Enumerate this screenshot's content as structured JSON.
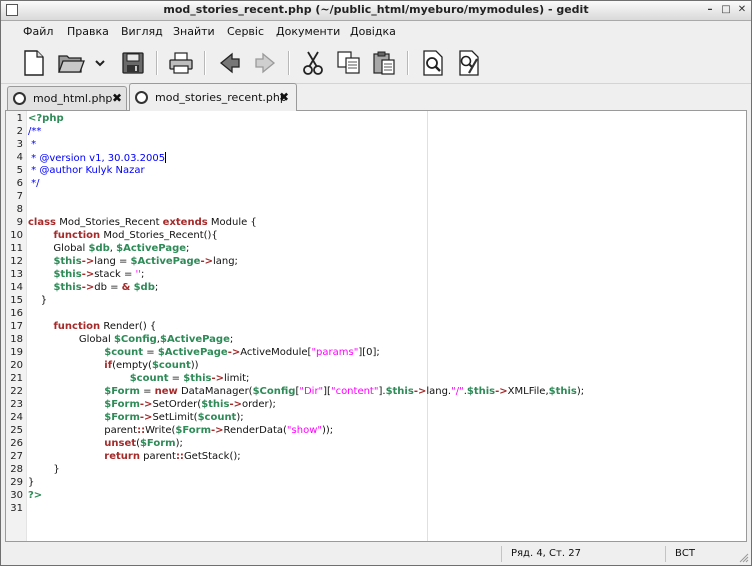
{
  "window": {
    "title": "mod_stories_recent.php (~/public_html/myeburo/mymodules) - gedit",
    "buttons": {
      "minimize": "–",
      "maximize": "□",
      "close": "✕"
    }
  },
  "menu": [
    "Файл",
    "Правка",
    "Вигляд",
    "Знайти",
    "Сервіс",
    "Документи",
    "Довідка"
  ],
  "toolbar": {
    "icons": [
      "new-document-icon",
      "open-folder-icon",
      "dropdown-arrow-icon",
      "save-icon",
      "print-icon",
      "back-arrow-icon",
      "forward-arrow-icon",
      "cut-icon",
      "copy-icon",
      "paste-icon",
      "find-icon",
      "replace-icon"
    ]
  },
  "tabs": [
    {
      "label": "mod_html.php",
      "close": "✖",
      "active": false
    },
    {
      "label": "mod_stories_recent.php",
      "close": "✖",
      "active": true
    }
  ],
  "editor": {
    "line_numbers": [
      "1",
      "2",
      "3",
      "4",
      "5",
      "6",
      "7",
      "8",
      "9",
      "10",
      "11",
      "12",
      "13",
      "14",
      "15",
      "16",
      "17",
      "18",
      "19",
      "20",
      "21",
      "22",
      "23",
      "24",
      "25",
      "26",
      "27",
      "28",
      "29",
      "30",
      "31"
    ],
    "lines": [
      [
        {
          "t": "<?php",
          "c": "v"
        }
      ],
      [
        {
          "t": "/**",
          "c": "c"
        }
      ],
      [
        {
          "t": " *",
          "c": "c"
        }
      ],
      [
        {
          "t": " * @version v1, 30.03.2005",
          "c": "c"
        }
      ],
      [
        {
          "t": " * @author Kulyk Nazar",
          "c": "c"
        }
      ],
      [
        {
          "t": " */",
          "c": "c"
        }
      ],
      [],
      [],
      [
        {
          "t": "class",
          "c": "k"
        },
        {
          "t": " Mod_Stories_Recent "
        },
        {
          "t": "extends",
          "c": "k"
        },
        {
          "t": " Module {"
        }
      ],
      [
        {
          "t": "        "
        },
        {
          "t": "function",
          "c": "k"
        },
        {
          "t": " Mod_Stories_Recent(){"
        }
      ],
      [
        {
          "t": "        Global "
        },
        {
          "t": "$db",
          "c": "v"
        },
        {
          "t": ", "
        },
        {
          "t": "$ActivePage",
          "c": "v"
        },
        {
          "t": ";"
        }
      ],
      [
        {
          "t": "        "
        },
        {
          "t": "$this",
          "c": "v"
        },
        {
          "t": "->",
          "c": "k"
        },
        {
          "t": "lang = "
        },
        {
          "t": "$ActivePage",
          "c": "v"
        },
        {
          "t": "->",
          "c": "k"
        },
        {
          "t": "lang;"
        }
      ],
      [
        {
          "t": "        "
        },
        {
          "t": "$this",
          "c": "v"
        },
        {
          "t": "->",
          "c": "k"
        },
        {
          "t": "stack = "
        },
        {
          "t": "''",
          "c": "s"
        },
        {
          "t": ";"
        }
      ],
      [
        {
          "t": "        "
        },
        {
          "t": "$this",
          "c": "v"
        },
        {
          "t": "->",
          "c": "k"
        },
        {
          "t": "db = "
        },
        {
          "t": "&",
          "c": "k"
        },
        {
          "t": " "
        },
        {
          "t": "$db",
          "c": "v"
        },
        {
          "t": ";"
        }
      ],
      [
        {
          "t": "    }"
        }
      ],
      [],
      [
        {
          "t": "        "
        },
        {
          "t": "function",
          "c": "k"
        },
        {
          "t": " Render() {"
        }
      ],
      [
        {
          "t": "                Global "
        },
        {
          "t": "$Config",
          "c": "v"
        },
        {
          "t": ","
        },
        {
          "t": "$ActivePage",
          "c": "v"
        },
        {
          "t": ";"
        }
      ],
      [
        {
          "t": "                        "
        },
        {
          "t": "$count",
          "c": "v"
        },
        {
          "t": " = "
        },
        {
          "t": "$ActivePage",
          "c": "v"
        },
        {
          "t": "->",
          "c": "k"
        },
        {
          "t": "ActiveModule["
        },
        {
          "t": "\"params\"",
          "c": "s"
        },
        {
          "t": "][0];"
        }
      ],
      [
        {
          "t": "                        "
        },
        {
          "t": "if",
          "c": "k"
        },
        {
          "t": "(empty("
        },
        {
          "t": "$count",
          "c": "v"
        },
        {
          "t": "))"
        }
      ],
      [
        {
          "t": "                                "
        },
        {
          "t": "$count",
          "c": "v"
        },
        {
          "t": " = "
        },
        {
          "t": "$this",
          "c": "v"
        },
        {
          "t": "->",
          "c": "k"
        },
        {
          "t": "limit;"
        }
      ],
      [
        {
          "t": "                        "
        },
        {
          "t": "$Form",
          "c": "v"
        },
        {
          "t": " = "
        },
        {
          "t": "new",
          "c": "k"
        },
        {
          "t": " DataManager("
        },
        {
          "t": "$Config",
          "c": "v"
        },
        {
          "t": "["
        },
        {
          "t": "\"Dir\"",
          "c": "s"
        },
        {
          "t": "]["
        },
        {
          "t": "\"content\"",
          "c": "s"
        },
        {
          "t": "]."
        },
        {
          "t": "$this",
          "c": "v"
        },
        {
          "t": "->",
          "c": "k"
        },
        {
          "t": "lang."
        },
        {
          "t": "\"/\"",
          "c": "s"
        },
        {
          "t": "."
        },
        {
          "t": "$this",
          "c": "v"
        },
        {
          "t": "->",
          "c": "k"
        },
        {
          "t": "XMLFile,"
        },
        {
          "t": "$this",
          "c": "v"
        },
        {
          "t": ");"
        }
      ],
      [
        {
          "t": "                        "
        },
        {
          "t": "$Form",
          "c": "v"
        },
        {
          "t": "->",
          "c": "k"
        },
        {
          "t": "SetOrder("
        },
        {
          "t": "$this",
          "c": "v"
        },
        {
          "t": "->",
          "c": "k"
        },
        {
          "t": "order);"
        }
      ],
      [
        {
          "t": "                        "
        },
        {
          "t": "$Form",
          "c": "v"
        },
        {
          "t": "->",
          "c": "k"
        },
        {
          "t": "SetLimit("
        },
        {
          "t": "$count",
          "c": "v"
        },
        {
          "t": ");"
        }
      ],
      [
        {
          "t": "                        parent"
        },
        {
          "t": "::",
          "c": "k"
        },
        {
          "t": "Write("
        },
        {
          "t": "$Form",
          "c": "v"
        },
        {
          "t": "->",
          "c": "k"
        },
        {
          "t": "RenderData("
        },
        {
          "t": "\"show\"",
          "c": "s"
        },
        {
          "t": "));"
        }
      ],
      [
        {
          "t": "                        "
        },
        {
          "t": "unset",
          "c": "k"
        },
        {
          "t": "("
        },
        {
          "t": "$Form",
          "c": "v"
        },
        {
          "t": ");"
        }
      ],
      [
        {
          "t": "                        "
        },
        {
          "t": "return",
          "c": "k"
        },
        {
          "t": " parent"
        },
        {
          "t": "::",
          "c": "k"
        },
        {
          "t": "GetStack();"
        }
      ],
      [
        {
          "t": "        }"
        }
      ],
      [
        {
          "t": "}"
        }
      ],
      [
        {
          "t": "?>",
          "c": "v"
        }
      ],
      []
    ]
  },
  "status": {
    "position": "Ряд. 4, Ст. 27",
    "mode": "ВСТ"
  }
}
